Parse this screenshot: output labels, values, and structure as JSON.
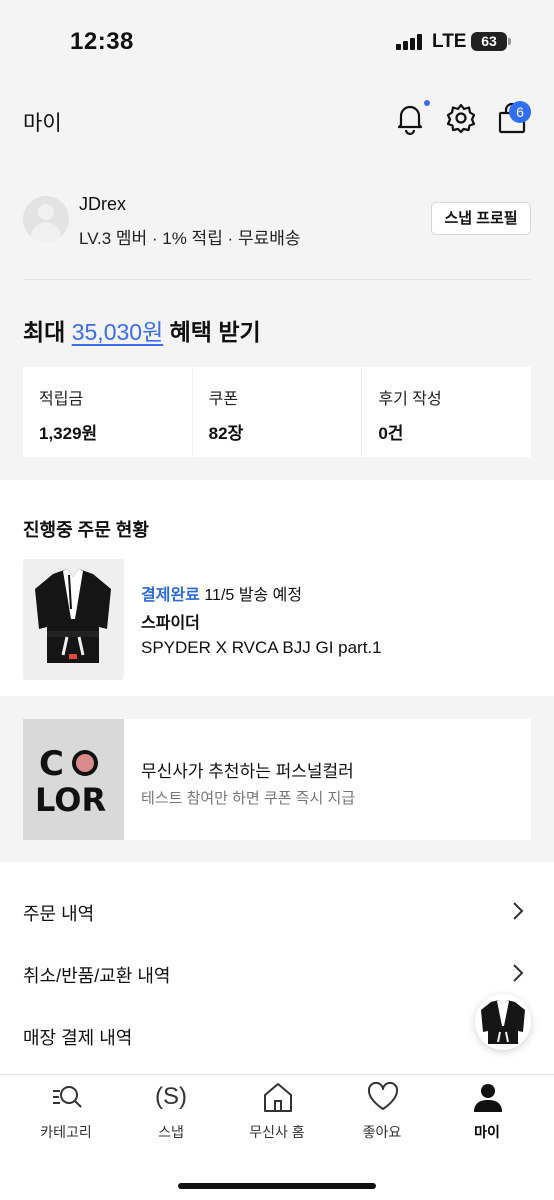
{
  "status_bar": {
    "time": "12:38",
    "network": "LTE",
    "battery": "63"
  },
  "header": {
    "title": "마이",
    "cart_badge": "6",
    "icons": [
      "bell-icon",
      "gear-icon",
      "shopping-bag-icon"
    ]
  },
  "profile": {
    "username": "JDrex",
    "member_info": "LV.3 멤버 · 1% 적립 · 무료배송",
    "snap_profile_button": "스냅 프로필"
  },
  "benefit": {
    "prefix": "최대 ",
    "amount": "35,030원",
    "suffix": " 혜택 받기"
  },
  "stats": [
    {
      "label": "적립금",
      "value": "1,329원"
    },
    {
      "label": "쿠폰",
      "value": "82장"
    },
    {
      "label": "후기 작성",
      "value": "0건"
    }
  ],
  "orders": {
    "title": "진행중 주문 현황",
    "item": {
      "status": "결제완료",
      "schedule": " 11/5 발송 예정",
      "brand": "스파이더",
      "name": "SPYDER X RVCA BJJ GI part.1"
    }
  },
  "promo": {
    "image_text": [
      "C",
      "LOR"
    ],
    "title": "무신사가 추천하는 퍼스널컬러",
    "subtitle": "테스트 참여만 하면 쿠폰 즉시 지급"
  },
  "menu": [
    {
      "label": "주문 내역"
    },
    {
      "label": "취소/반품/교환 내역"
    },
    {
      "label": "매장 결제 내역"
    }
  ],
  "tabbar": {
    "tabs": [
      {
        "label": "카테고리",
        "icon": "category-search-icon"
      },
      {
        "label": "스냅",
        "icon": "snap-icon"
      },
      {
        "label": "무신사 홈",
        "icon": "home-icon"
      },
      {
        "label": "좋아요",
        "icon": "heart-icon"
      },
      {
        "label": "마이",
        "icon": "person-icon"
      }
    ],
    "snap_icon_text": "(S)",
    "active": "마이"
  },
  "colors": {
    "accent": "#3c6df0",
    "status_blue": "#2b6cd9",
    "background": "#f4f4f4"
  }
}
